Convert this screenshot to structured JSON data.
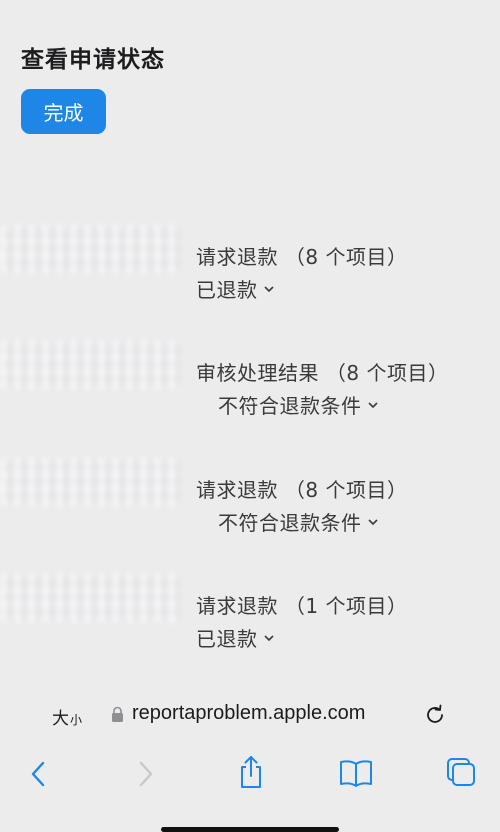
{
  "header": {
    "title": "查看申请状态",
    "done_label": "完成"
  },
  "requests": [
    {
      "title": "请求退款 （8 个项目）",
      "status": "已退款"
    },
    {
      "title": "审核处理结果 （8 个项目）",
      "status": "不符合退款条件"
    },
    {
      "title": "请求退款 （8 个项目）",
      "status": "不符合退款条件"
    },
    {
      "title": "请求退款 （1 个项目）",
      "status": "已退款"
    }
  ],
  "browser": {
    "text_size_big": "大",
    "text_size_small": "小",
    "url": "reportaproblem.apple.com"
  },
  "colors": {
    "accent": "#1d86e6",
    "background": "#ececec",
    "toolbar_icon": "#1d86e6",
    "disabled_icon": "#c7c7cc"
  },
  "icons": {
    "back": "chevron-left-icon",
    "forward": "chevron-right-icon",
    "share": "share-icon",
    "bookmarks": "book-icon",
    "tabs": "tabs-icon",
    "lock": "lock-icon",
    "reload": "reload-icon"
  }
}
